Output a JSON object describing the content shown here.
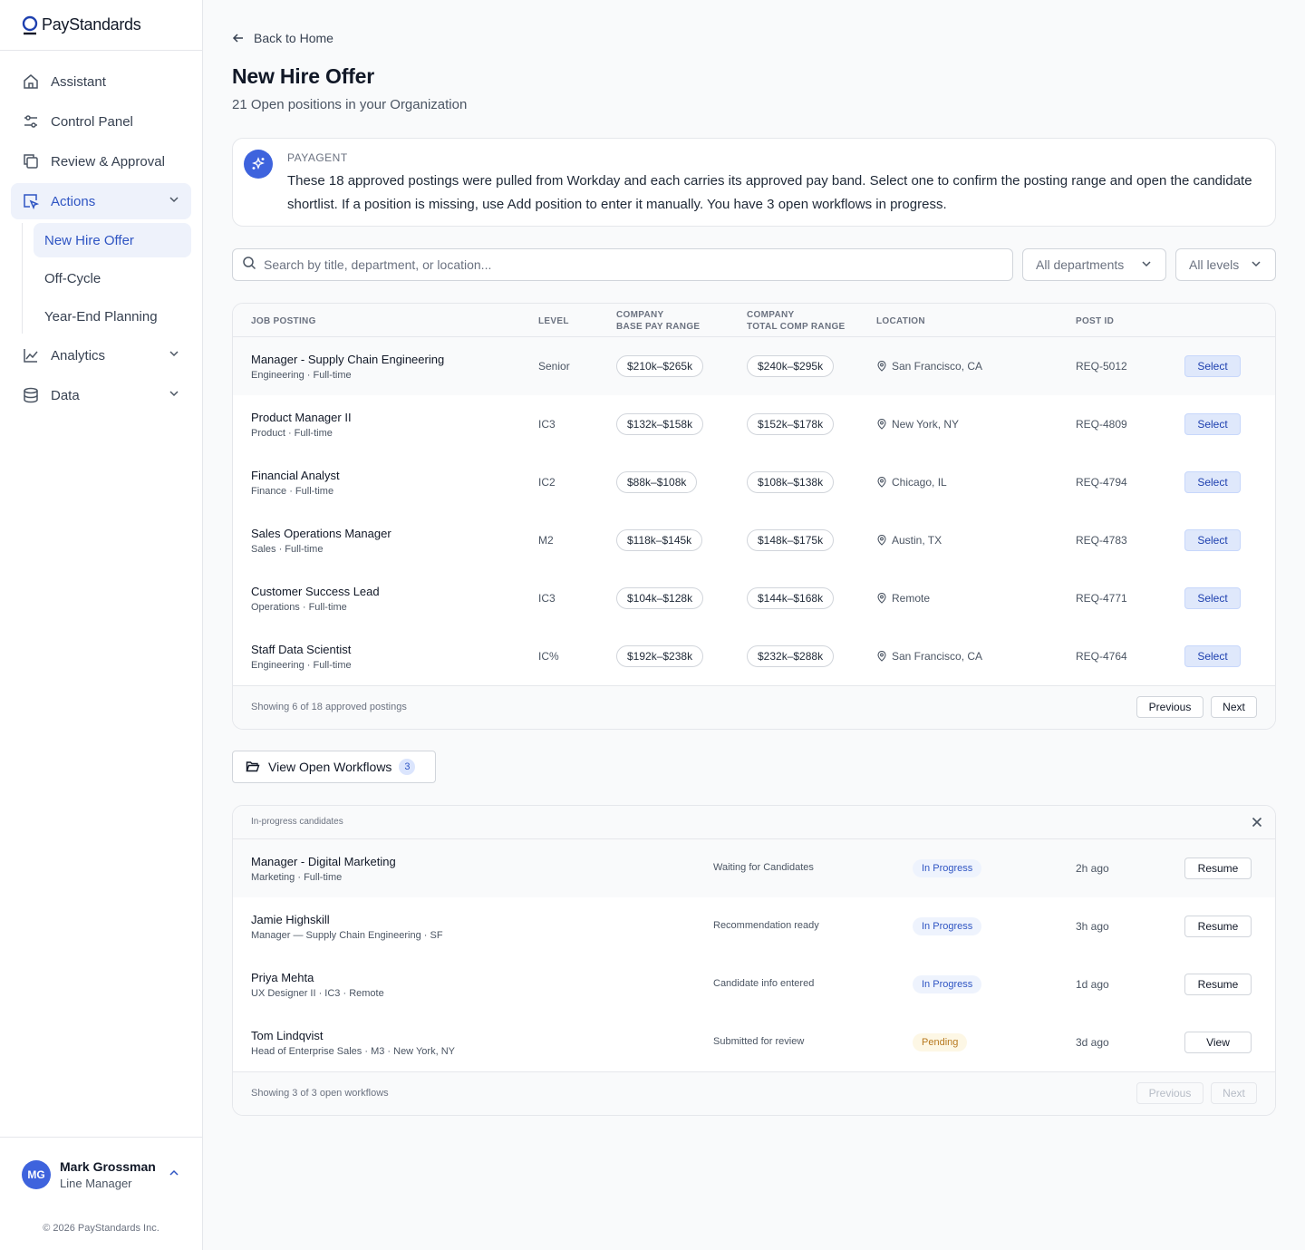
{
  "brand": {
    "name": "PayStandards"
  },
  "sidebar": {
    "items": [
      {
        "label": "Assistant",
        "icon": "home-icon"
      },
      {
        "label": "Control Panel",
        "icon": "sliders-icon"
      },
      {
        "label": "Review & Approval",
        "icon": "copy-icon"
      },
      {
        "label": "Actions",
        "icon": "cursor-icon"
      },
      {
        "label": "Analytics",
        "icon": "chart-icon"
      },
      {
        "label": "Data",
        "icon": "database-icon"
      }
    ],
    "sub_items": [
      {
        "label": "New Hire Offer"
      },
      {
        "label": "Off-Cycle"
      },
      {
        "label": "Year-End Planning"
      }
    ]
  },
  "user": {
    "initials": "MG",
    "name": "Mark Grossman",
    "role": "Line Manager"
  },
  "copyright": "© 2026 PayStandards Inc.",
  "header": {
    "back_label": "Back to Home",
    "title": "New Hire Offer",
    "subtitle": "21 Open positions in your Organization"
  },
  "agent": {
    "label": "PAYAGENT",
    "message": "These 18 approved postings were pulled from Workday and each carries its approved pay band. Select one to confirm the posting range and open the candidate shortlist. If a position is missing, use Add position to enter it manually. You have 3 open workflows in progress."
  },
  "filters": {
    "search_placeholder": "Search by title, department, or location...",
    "department": "All departments",
    "level": "All levels"
  },
  "postings": {
    "columns": {
      "job": "JOB POSTING",
      "level": "LEVEL",
      "base_1": "COMPANY",
      "base_2": "BASE PAY RANGE",
      "total_1": "COMPANY",
      "total_2": "TOTAL COMP RANGE",
      "location": "LOCATION",
      "post_id": "POST ID"
    },
    "rows": [
      {
        "title": "Manager - Supply Chain Engineering",
        "sub": "Engineering · Full-time",
        "level": "Senior",
        "base": "$210k–$265k",
        "total": "$240k–$295k",
        "location": "San Francisco, CA",
        "post_id": "REQ-5012",
        "action": "Select"
      },
      {
        "title": "Product Manager II",
        "sub": "Product · Full-time",
        "level": "IC3",
        "base": "$132k–$158k",
        "total": "$152k–$178k",
        "location": "New York, NY",
        "post_id": "REQ-4809",
        "action": "Select"
      },
      {
        "title": "Financial Analyst",
        "sub": "Finance · Full-time",
        "level": "IC2",
        "base": "$88k–$108k",
        "total": "$108k–$138k",
        "location": "Chicago, IL",
        "post_id": "REQ-4794",
        "action": "Select"
      },
      {
        "title": "Sales Operations Manager",
        "sub": "Sales · Full-time",
        "level": "M2",
        "base": "$118k–$145k",
        "total": "$148k–$175k",
        "location": "Austin, TX",
        "post_id": "REQ-4783",
        "action": "Select"
      },
      {
        "title": "Customer Success Lead",
        "sub": "Operations · Full-time",
        "level": "IC3",
        "base": "$104k–$128k",
        "total": "$144k–$168k",
        "location": "Remote",
        "post_id": "REQ-4771",
        "action": "Select"
      },
      {
        "title": "Staff Data Scientist",
        "sub": "Engineering · Full-time",
        "level": "IC%",
        "base": "$192k–$238k",
        "total": "$232k–$288k",
        "location": "San Francisco, CA",
        "post_id": "REQ-4764",
        "action": "Select"
      }
    ],
    "footer": "Showing 6 of 18 approved postings",
    "prev": "Previous",
    "next": "Next"
  },
  "workflows_button": {
    "label": "View Open Workflows",
    "count": "3"
  },
  "workflows": {
    "header": "In-progress candidates",
    "rows": [
      {
        "title": "Manager - Digital Marketing",
        "sub": "Marketing · Full-time",
        "status": "Waiting for Candidates",
        "chip": "In Progress",
        "time": "2h ago",
        "action": "Resume"
      },
      {
        "title": "Jamie Highskill",
        "sub": "Manager — Supply Chain Engineering · SF",
        "status": "Recommendation ready",
        "chip": "In Progress",
        "time": "3h ago",
        "action": "Resume"
      },
      {
        "title": "Priya Mehta",
        "sub": "UX Designer II · IC3 · Remote",
        "status": "Candidate info entered",
        "chip": "In Progress",
        "time": "1d ago",
        "action": "Resume"
      },
      {
        "title": "Tom Lindqvist",
        "sub": "Head of Enterprise Sales · M3 · New York, NY",
        "status": "Submitted for review",
        "chip": "Pending",
        "time": "3d ago",
        "action": "View"
      }
    ],
    "footer": "Showing 3 of 3 open workflows",
    "prev": "Previous",
    "next": "Next"
  },
  "colors": {
    "accent": "#3e63dd",
    "active_bg": "#eef2fb",
    "pending": "#b7791f"
  }
}
